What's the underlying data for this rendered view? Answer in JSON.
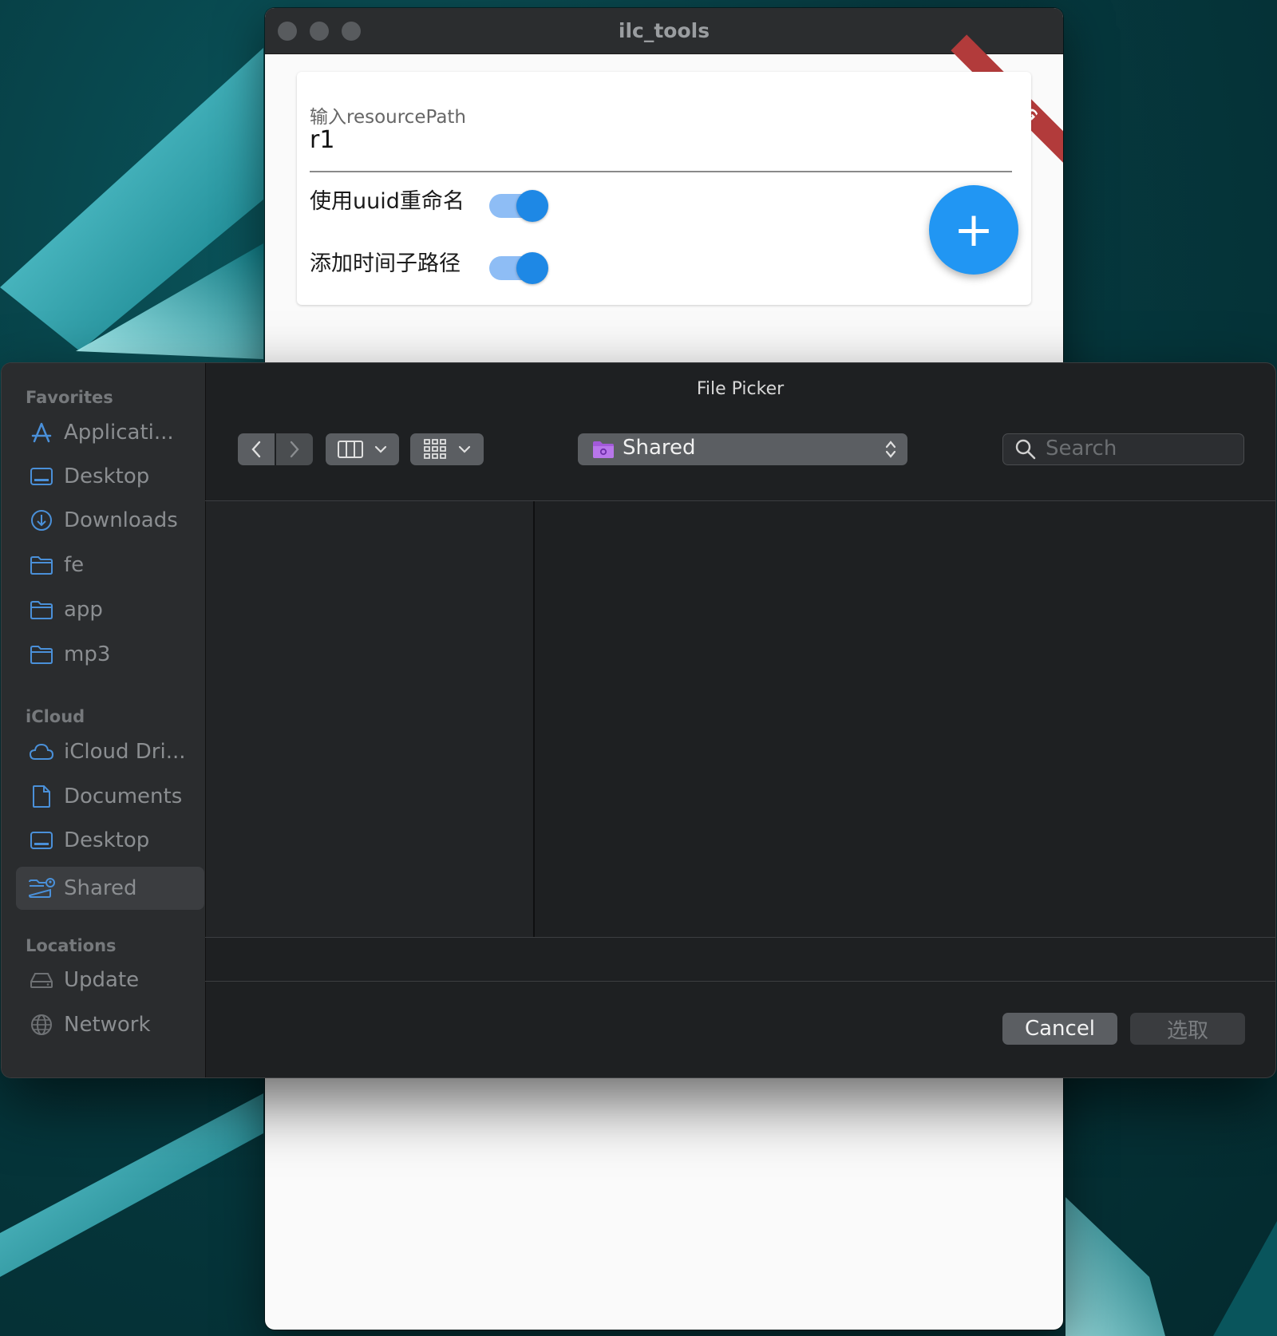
{
  "app": {
    "title": "ilc_tools",
    "debug_label": "DEBUG",
    "field_label": "输入resourcePath",
    "field_value": "r1",
    "option_uuid": "使用uuid重命名",
    "option_time_path": "添加时间子路径",
    "option_uuid_on": true,
    "option_time_path_on": true,
    "fab_symbol": "+"
  },
  "picker": {
    "title": "File Picker",
    "sections": [
      {
        "header": "Favorites",
        "items": [
          {
            "label": "Applicati...",
            "icon": "applications-icon"
          },
          {
            "label": "Desktop",
            "icon": "desktop-icon"
          },
          {
            "label": "Downloads",
            "icon": "downloads-icon"
          },
          {
            "label": "fe",
            "icon": "folder-icon"
          },
          {
            "label": "app",
            "icon": "folder-icon"
          },
          {
            "label": "mp3",
            "icon": "folder-icon"
          }
        ]
      },
      {
        "header": "iCloud",
        "items": [
          {
            "label": "iCloud Dri...",
            "icon": "cloud-icon"
          },
          {
            "label": "Documents",
            "icon": "document-icon"
          },
          {
            "label": "Desktop",
            "icon": "desktop-icon"
          },
          {
            "label": "Shared",
            "icon": "shared-folder-icon",
            "selected": true
          }
        ]
      },
      {
        "header": "Locations",
        "items": [
          {
            "label": "Update",
            "icon": "drive-icon"
          },
          {
            "label": "Network",
            "icon": "globe-icon"
          }
        ]
      }
    ],
    "path_label": "Shared",
    "search_placeholder": "Search",
    "cancel_label": "Cancel",
    "choose_label": "选取",
    "accent_color": "#2196f3",
    "folder_color": "#a259d9"
  }
}
